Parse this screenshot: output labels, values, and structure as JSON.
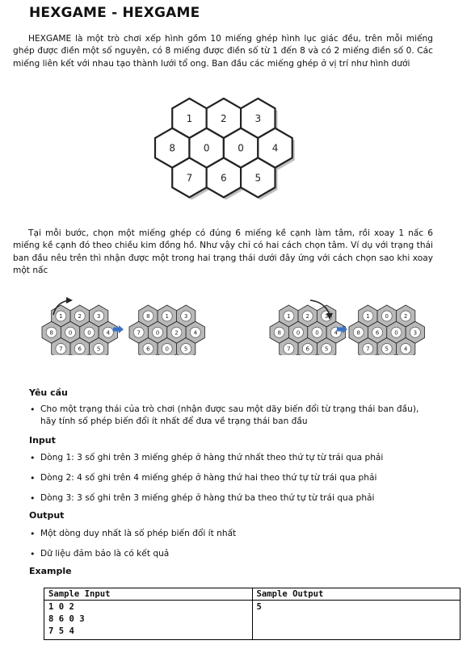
{
  "title": "HEXGAME - HEXGAME",
  "intro": "HEXGAME là một trò chơi xếp hình gồm 10 miếng ghép hình lục giác đều, trên mỗi miếng ghép được điền một số nguyên, có 8 miếng được điền số từ 1 đến 8 và có 2 miếng điền số 0. Các miếng liên kết với nhau tạo thành lưới tổ ong. Ban đầu các miếng ghép ở vị trí như hình dưới",
  "main_figure": {
    "row1": [
      "1",
      "2",
      "3"
    ],
    "row2": [
      "8",
      "0",
      "0",
      "4"
    ],
    "row3": [
      "7",
      "6",
      "5"
    ]
  },
  "step_text": "Tại mỗi bước, chọn một miếng ghép có đúng 6 miếng kề cạnh làm tâm, rồi xoay 1 nấc 6 miếng kề cạnh đó theo chiều kim đồng hồ. Như vậy chỉ có hai cách chọn tâm. Ví dụ với trạng thái ban đầu nêu trên thì nhận được một trong hai trạng thái dưới đây ứng với cách chọn sao khi xoay một nấc",
  "examples": [
    {
      "before": {
        "row1": [
          "1",
          "2",
          "3"
        ],
        "row2": [
          "8",
          "0",
          "0",
          "4"
        ],
        "row3": [
          "7",
          "6",
          "5"
        ]
      },
      "after": {
        "row1": [
          "8",
          "1",
          "3"
        ],
        "row2": [
          "7",
          "0",
          "2",
          "4"
        ],
        "row3": [
          "6",
          "0",
          "5"
        ]
      }
    },
    {
      "before": {
        "row1": [
          "1",
          "2",
          "3"
        ],
        "row2": [
          "8",
          "0",
          "0",
          "4"
        ],
        "row3": [
          "7",
          "6",
          "5"
        ]
      },
      "after": {
        "row1": [
          "1",
          "0",
          "2"
        ],
        "row2": [
          "8",
          "6",
          "0",
          "3"
        ],
        "row3": [
          "7",
          "5",
          "4"
        ]
      }
    }
  ],
  "sections": {
    "requirement_title": "Yêu cầu",
    "requirement_items": [
      "Cho một trạng thái của trò chơi (nhận được sau một dãy biến đổi từ trạng thái ban đầu), hãy tính số phép biến đổi ít nhất để đưa về trạng thái ban đầu"
    ],
    "input_title": "Input",
    "input_items": [
      "Dòng 1: 3 số ghi trên 3 miếng ghép ở hàng thứ nhất theo thứ tự từ trái qua phải",
      "Dòng 2: 4 số ghi trên 4 miếng ghép ở hàng thứ hai theo thứ tự từ trái qua phải",
      "Dòng 3: 3 số ghi trên 3 miếng ghép ở hàng thứ ba theo thứ tự từ trái qua phải"
    ],
    "output_title": "Output",
    "output_items": [
      "Một dòng duy nhất là số phép biến đổi ít nhất",
      "Dữ liệu đảm bảo là có kết quả"
    ],
    "example_title": "Example"
  },
  "sample": {
    "input_header": "Sample Input",
    "output_header": "Sample Output",
    "input_lines": [
      "1 0 2",
      "8 6 0 3",
      "7 5 4"
    ],
    "output_lines": [
      "5"
    ]
  }
}
